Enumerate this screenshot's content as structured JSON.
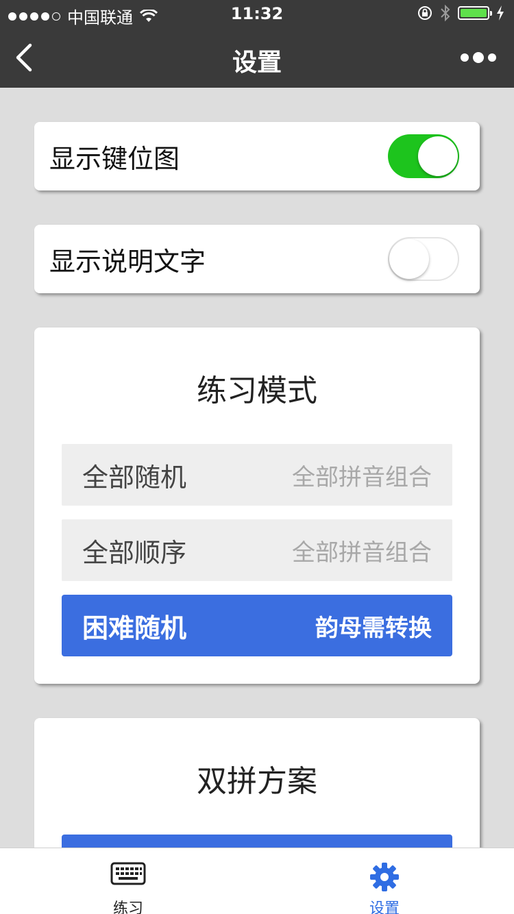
{
  "status_bar": {
    "carrier": "中国联通",
    "time": "11:32"
  },
  "nav": {
    "title": "设置"
  },
  "toggles": [
    {
      "label": "显示键位图",
      "on": true
    },
    {
      "label": "显示说明文字",
      "on": false
    }
  ],
  "practice_mode": {
    "title": "练习模式",
    "options": [
      {
        "name": "全部随机",
        "desc": "全部拼音组合",
        "selected": false
      },
      {
        "name": "全部顺序",
        "desc": "全部拼音组合",
        "selected": false
      },
      {
        "name": "困难随机",
        "desc": "韵母需转换",
        "selected": true
      }
    ]
  },
  "scheme": {
    "title": "双拼方案"
  },
  "tabbar": {
    "tabs": [
      {
        "label": "练习",
        "icon": "keyboard-icon",
        "active": false
      },
      {
        "label": "设置",
        "icon": "gear-icon",
        "active": true
      }
    ]
  },
  "colors": {
    "bar_bg": "#3a3a3a",
    "switch_on": "#1dc41d",
    "selected_option": "#3b6ee0",
    "active_tab": "#2f6de3",
    "battery": "#5ee04b"
  }
}
